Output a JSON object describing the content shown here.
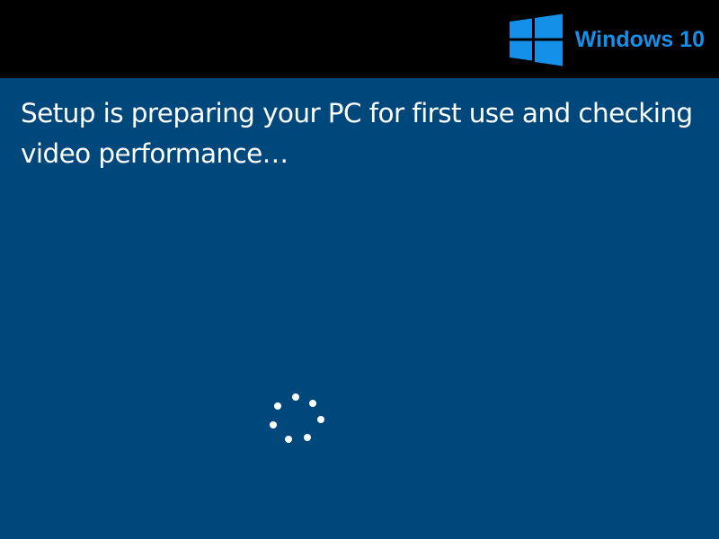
{
  "branding": {
    "product_name": "Windows 10",
    "logo_icon": "windows-logo-icon",
    "accent_color": "#1490e8"
  },
  "setup": {
    "message": "Setup is preparing your PC for first use and checking video performance…",
    "background_color": "#00487c",
    "status_indicator": "spinner-icon"
  }
}
